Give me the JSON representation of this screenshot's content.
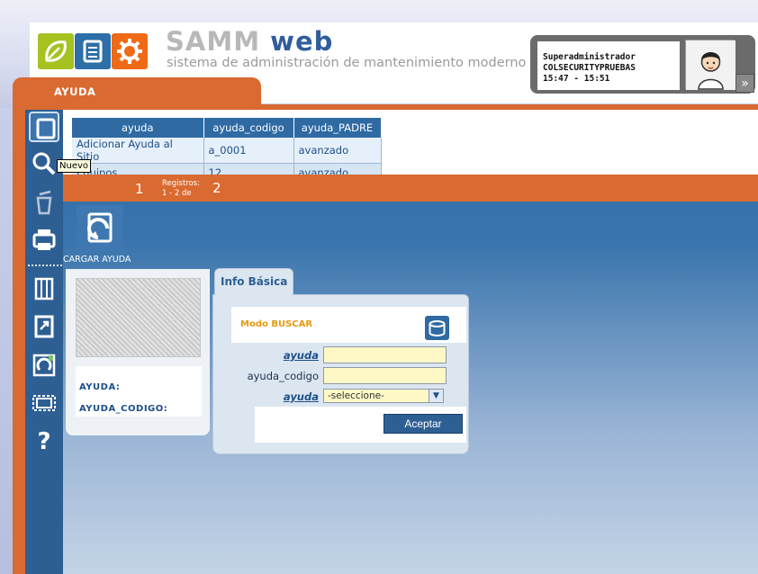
{
  "app": {
    "brand_samm": "SAMM",
    "brand_web": "web",
    "tagline": "sistema de administración de mantenimiento moderno"
  },
  "user": {
    "role": "Superadministrador",
    "company": "COLSECURITYPRUEBAS",
    "time": "15:47 - 15:51"
  },
  "module": {
    "title": "AYUDA"
  },
  "toolbar": {
    "tooltip": "Nuevo",
    "help_glyph": "?"
  },
  "grid": {
    "columns": [
      "ayuda",
      "ayuda_codigo",
      "ayuda_PADRE"
    ],
    "rows": [
      [
        "Adicionar Ayuda al Sitio",
        "a_0001",
        "avanzado"
      ],
      [
        "Equipos",
        "12",
        "avanzado"
      ]
    ]
  },
  "pager": {
    "page": "1",
    "registros_label": "Registros:",
    "range_label": "1 - 2 de",
    "total": "2"
  },
  "load": {
    "label": "CARGAR AYUDA"
  },
  "card": {
    "label_ayuda": "AYUDA:",
    "label_codigo": "AYUDA_CODIGO:"
  },
  "form": {
    "tab_label": "Info Básica",
    "mode_label": "Modo BUSCAR",
    "field_ayuda_label": "ayuda",
    "field_codigo_label": "ayuda_codigo",
    "field_padre_label": "ayuda",
    "ayuda_value": "",
    "codigo_value": "",
    "padre_selected": "-seleccione-",
    "accept_label": "Aceptar"
  },
  "colors": {
    "orange": "#d96a31",
    "blue_dark": "#2e5f93",
    "blue": "#2f6aa3",
    "input_bg": "#fdf8c6"
  }
}
